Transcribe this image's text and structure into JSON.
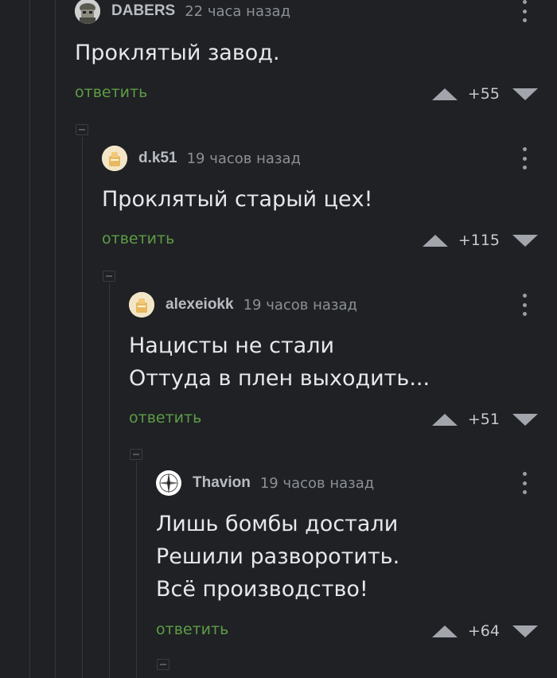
{
  "comments": [
    {
      "username": "DABERS",
      "time": "22 часа назад",
      "lines": [
        "Проклятый завод."
      ],
      "reply": "ответить",
      "score": "+55",
      "avatar_icon": "soldier-avatar-icon"
    },
    {
      "username": "d.k51",
      "time": "19 часов назад",
      "lines": [
        "Проклятый старый цех!"
      ],
      "reply": "ответить",
      "score": "+115",
      "avatar_icon": "default-avatar-icon"
    },
    {
      "username": "alexeiokk",
      "time": "19 часов назад",
      "lines": [
        "Нацисты не стали",
        "Оттуда в плен выходить..."
      ],
      "reply": "ответить",
      "score": "+51",
      "avatar_icon": "default-avatar-icon"
    },
    {
      "username": "Thavion",
      "time": "19 часов назад",
      "lines": [
        "Лишь бомбы достали",
        "Решили разворотить.",
        "Всё производство!"
      ],
      "reply": "ответить",
      "score": "+64",
      "avatar_icon": "compass-avatar-icon"
    }
  ],
  "colors": {
    "background": "#1f2124",
    "reply_link": "#5e9c46",
    "text": "#e6e8eb",
    "muted": "#8c9096"
  }
}
